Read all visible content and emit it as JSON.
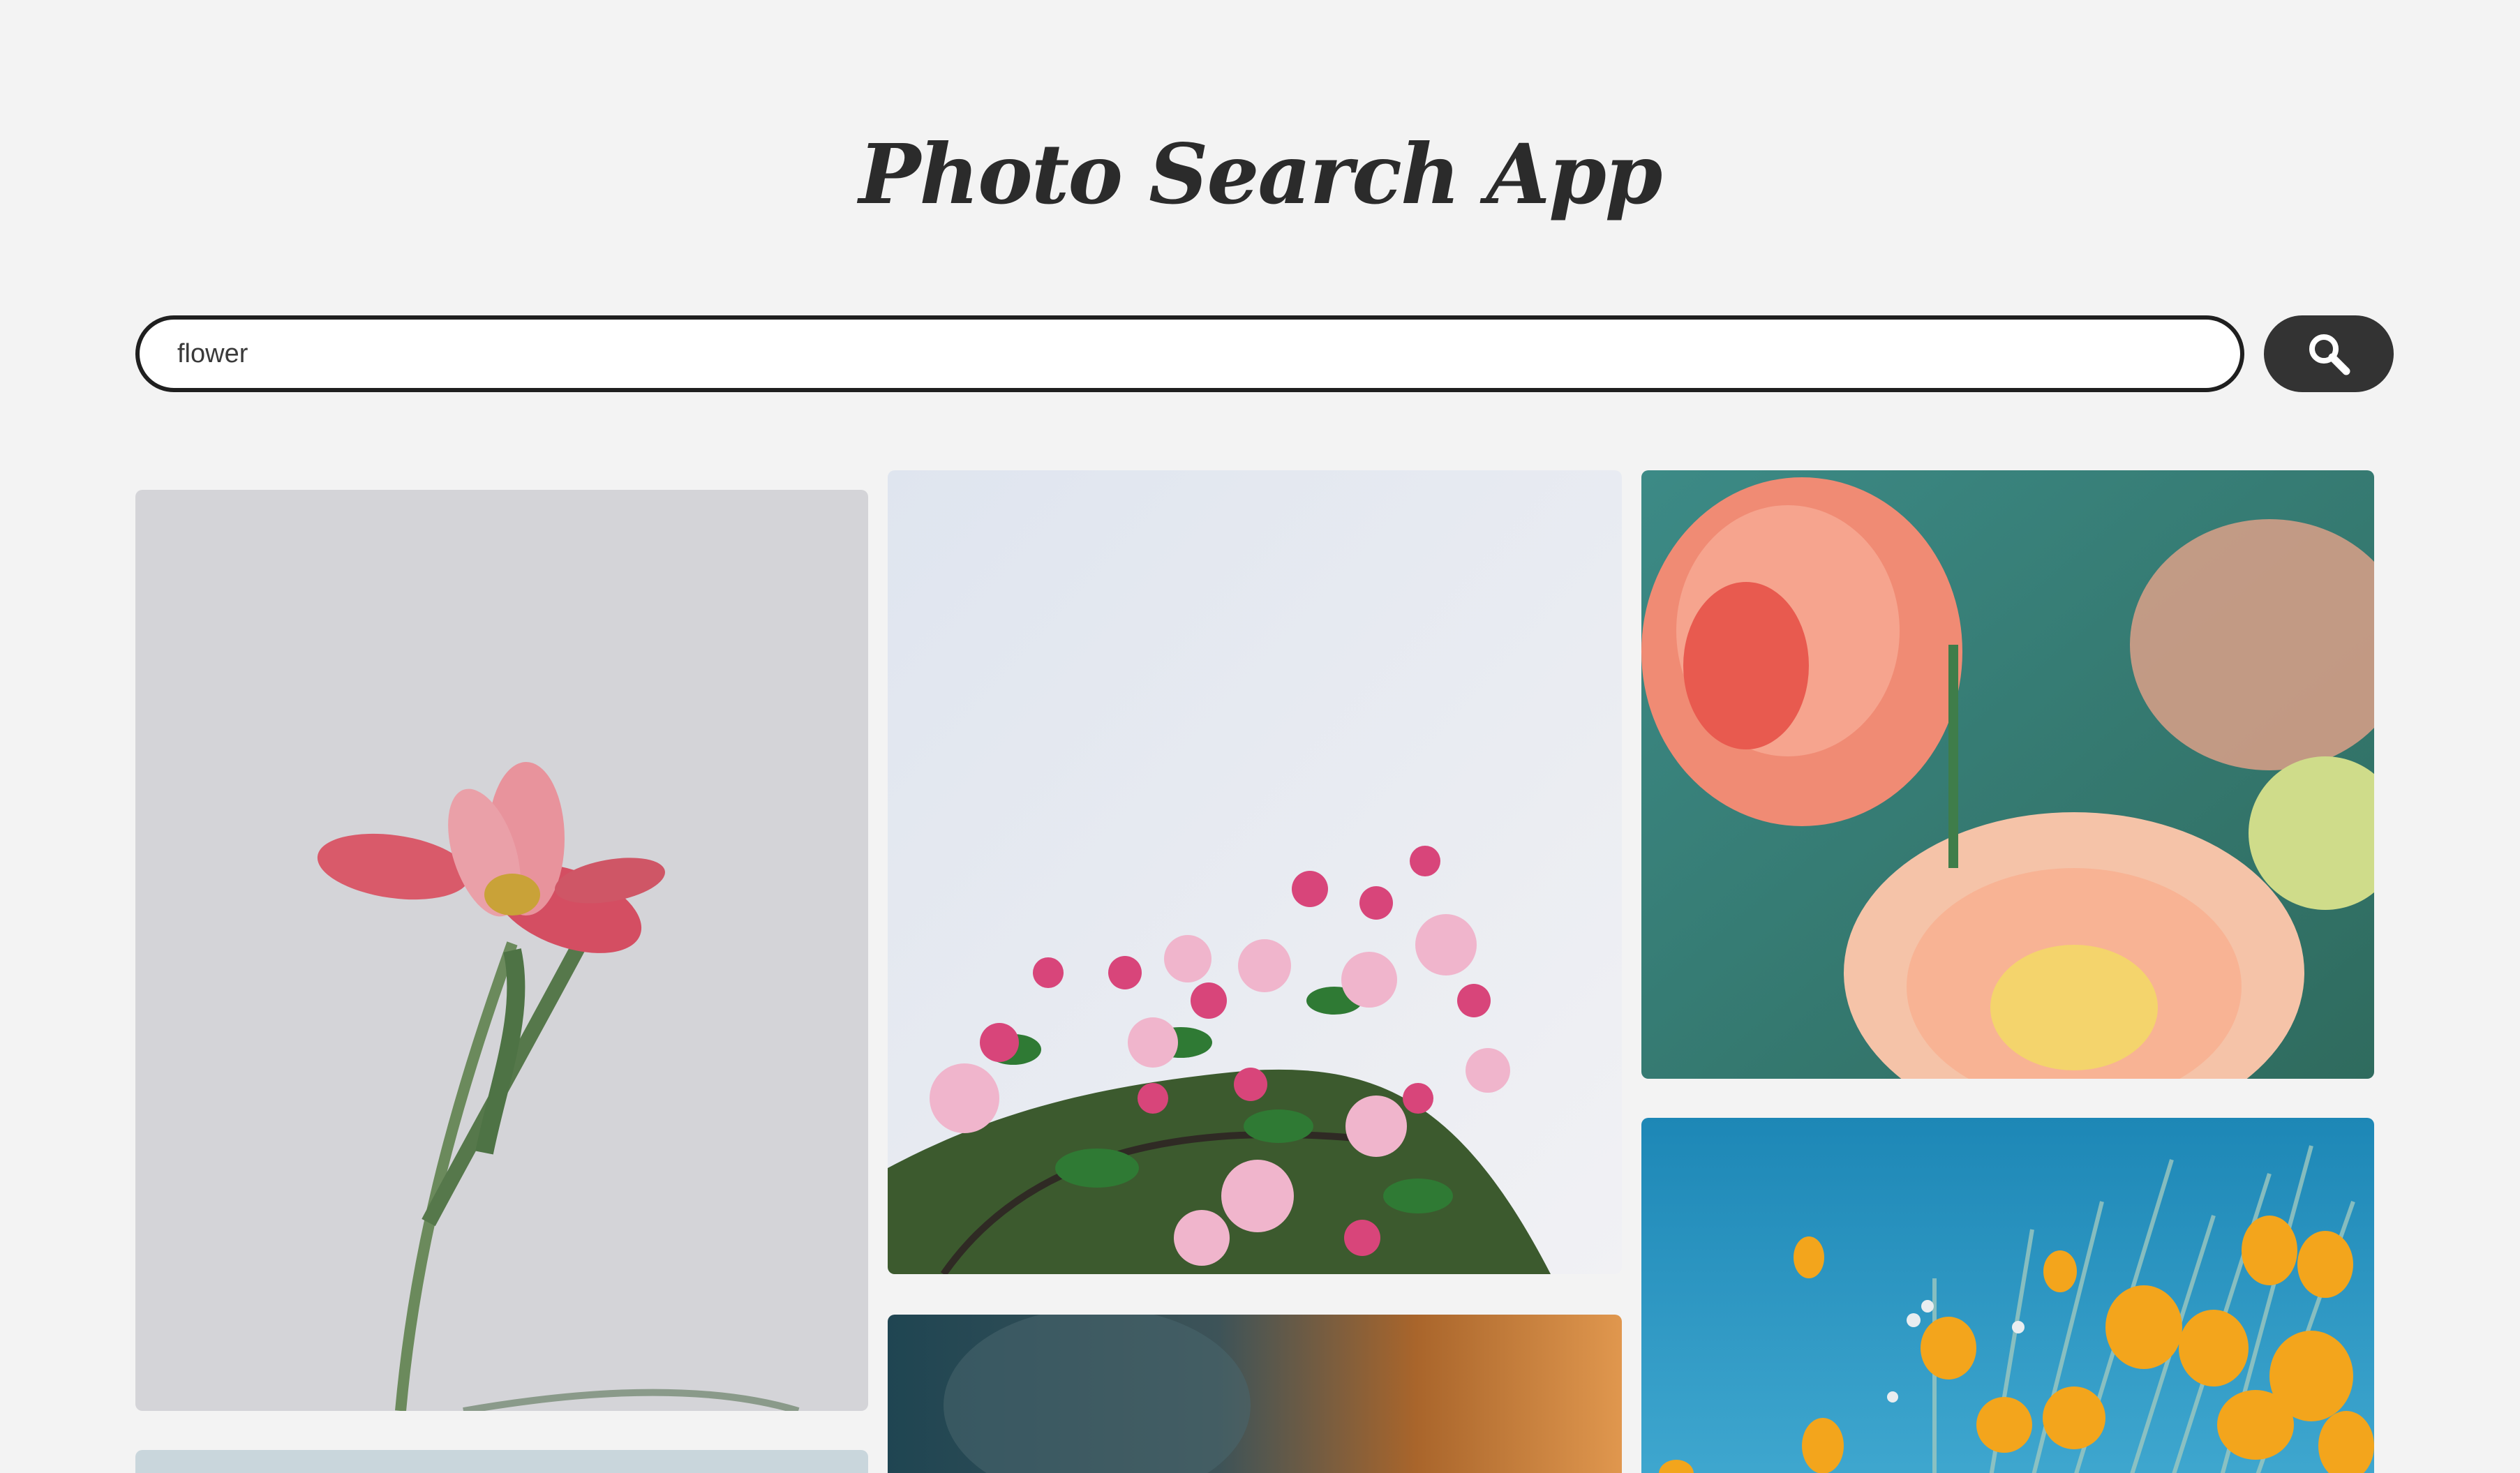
{
  "header": {
    "title": "Photo Search App"
  },
  "search": {
    "value": "flower",
    "placeholder": "",
    "button_icon": "search-icon"
  },
  "colors": {
    "background": "#f3f3f3",
    "title": "#2b2b2b",
    "search_border": "#1f1f1f",
    "button_bg": "#333333",
    "button_icon": "#ffffff"
  },
  "results": [
    {
      "column": 1,
      "subject": "pink iris flower on grey background"
    },
    {
      "column": 2,
      "subject": "pink blossoms against pale sky"
    },
    {
      "column": 3,
      "subject": "peach and coral dahlias"
    },
    {
      "column": 3,
      "subject": "orange poppies under blue sky"
    },
    {
      "column": 2,
      "subject": "blurred dark and orange photo"
    },
    {
      "column": 1,
      "subject": "pale blue-grey photo"
    }
  ]
}
